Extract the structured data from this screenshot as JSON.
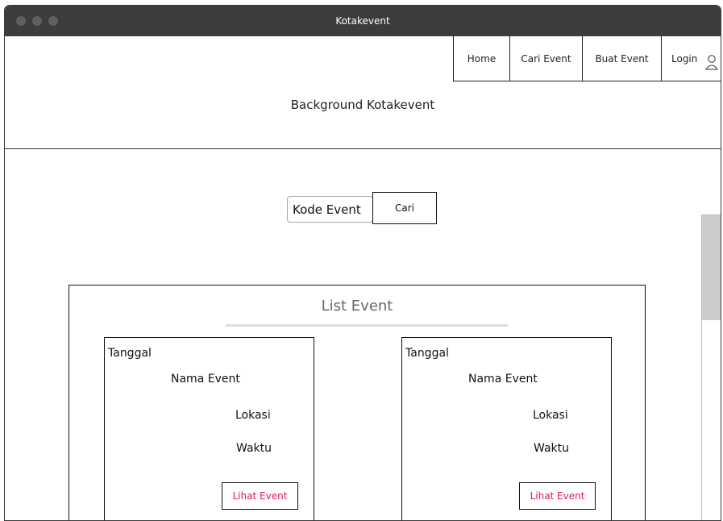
{
  "window": {
    "title": "Kotakevent"
  },
  "header": {
    "background_label": "Background Kotakevent",
    "nav": {
      "home": "Home",
      "cari_event": "Cari Event",
      "buat_event": "Buat Event",
      "login": "Login"
    }
  },
  "search": {
    "input_value": "Kode Event",
    "button_label": "Cari"
  },
  "list": {
    "title": "List Event",
    "cards": [
      {
        "date": "Tanggal",
        "name": "Nama Event",
        "location": "Lokasi",
        "time": "Waktu",
        "button_label": "Lihat Event"
      },
      {
        "date": "Tanggal",
        "name": "Nama Event",
        "location": "Lokasi",
        "time": "Waktu",
        "button_label": "Lihat Event"
      }
    ]
  },
  "colors": {
    "titlebar": "#3c3c3c",
    "link_text": "#e0195a"
  },
  "icons": {
    "login": "user-icon"
  }
}
